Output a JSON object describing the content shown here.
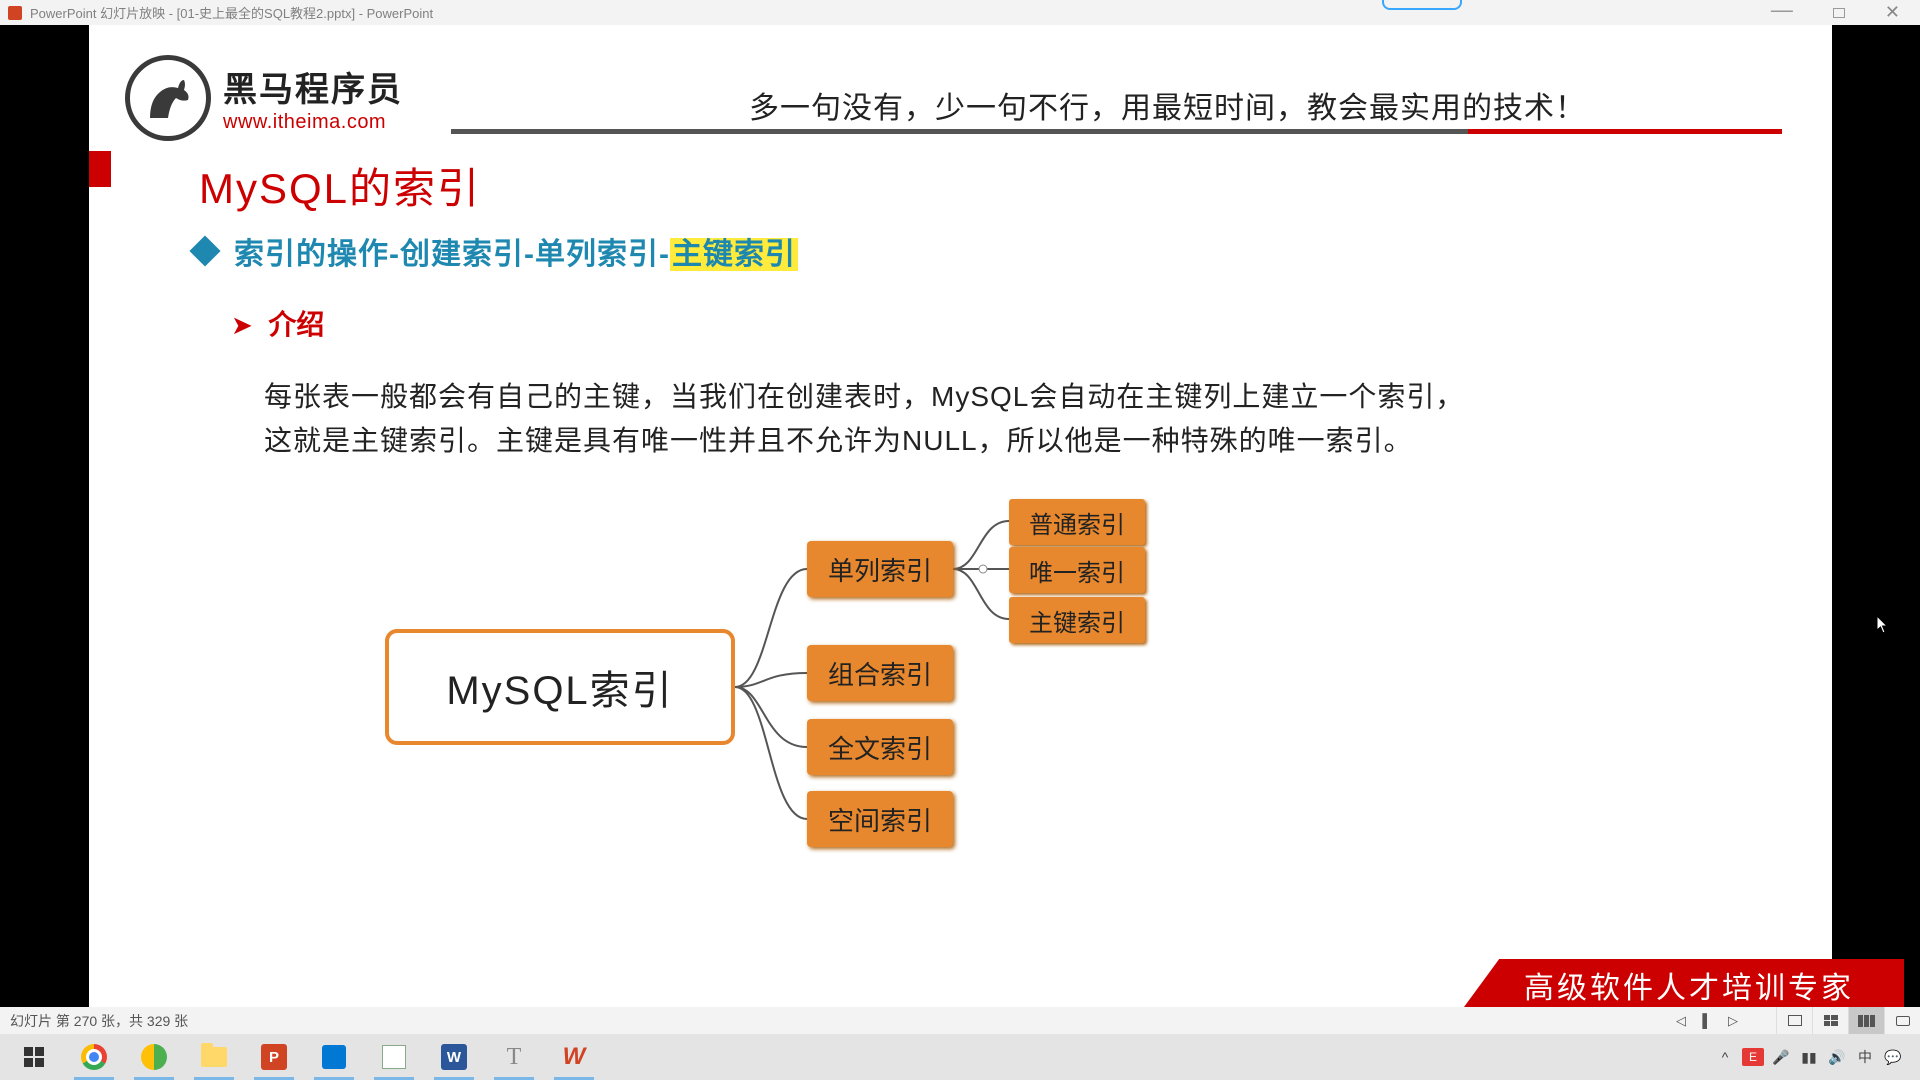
{
  "titlebar": {
    "title": "PowerPoint 幻灯片放映 - [01-史上最全的SQL教程2.pptx] - PowerPoint"
  },
  "slide": {
    "logo_cn": "黑马程序员",
    "logo_url": "www.itheima.com",
    "slogan": "多一句没有，少一句不行，用最短时间，教会最实用的技术！",
    "title": "MySQL的索引",
    "subtitle_prefix": "索引的操作-创建索引-单列索引-",
    "subtitle_hl": "主键索引",
    "section_label": "介绍",
    "body_line1": "每张表一般都会有自己的主键，当我们在创建表时，MySQL会自动在主键列上建立一个索引，",
    "body_line2": "这就是主键索引。主键是具有唯一性并且不允许为NULL，所以他是一种特殊的唯一索引。",
    "diagram": {
      "root": "MySQL索引",
      "level2": [
        "单列索引",
        "组合索引",
        "全文索引",
        "空间索引"
      ],
      "level3": [
        "普通索引",
        "唯一索引",
        "主键索引"
      ]
    },
    "banner": "高级软件人才培训专家"
  },
  "statusbar": {
    "counter": "幻灯片 第 270 张，共 329 张"
  },
  "taskbar": {
    "items": [
      "windows",
      "chrome",
      "360",
      "explorer",
      "powerpoint",
      "calculator",
      "notepad++",
      "word",
      "typora",
      "wps"
    ]
  },
  "colors": {
    "accent_red": "#c00",
    "accent_teal": "#1e88b0",
    "box_orange": "#e8882e"
  }
}
